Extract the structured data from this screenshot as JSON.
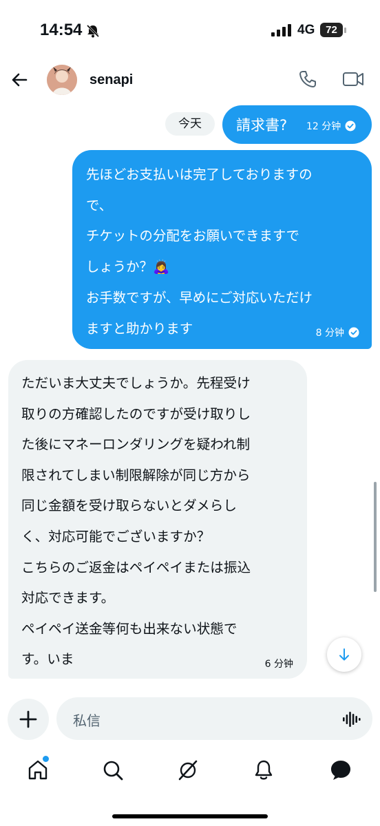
{
  "status_bar": {
    "time": "14:54",
    "network": "4G",
    "battery": "72"
  },
  "header": {
    "username": "senapi"
  },
  "messages": {
    "day_label": "今天",
    "out1": {
      "text": "請求書?",
      "time": "12 分钟"
    },
    "out2": {
      "lines": [
        "先ほどお支払いは完了しておりますの",
        "で、",
        "チケットの分配をお願いできますで",
        "しょうか？🙇‍♀️",
        "お手数ですが、早めにご対応いただけ",
        "ますと助かります"
      ],
      "time": "8 分钟"
    },
    "in1": {
      "lines": [
        "ただいま大丈夫でしょうか。先程受け",
        "取りの方確認したのですが受け取りし",
        "た後にマネーロンダリングを疑われ制",
        "限されてしまい制限解除が同じ方から",
        "同じ金額を受け取らないとダメらし",
        "く、対応可能でございますか？",
        "こちらのご返金はペイペイまたは振込",
        "対応できます。",
        "ペイペイ送金等何も出来ない状態で",
        "す。いま"
      ],
      "time": "6 分钟"
    }
  },
  "composer": {
    "placeholder": "私信"
  },
  "tabs": [
    {
      "icon": "home-icon"
    },
    {
      "icon": "search-icon"
    },
    {
      "icon": "grok-icon"
    },
    {
      "icon": "notifications-icon"
    },
    {
      "icon": "messages-icon"
    }
  ],
  "colors": {
    "accent": "#1d9bf0",
    "bubble_in": "#eff3f4",
    "text": "#0f1419"
  }
}
